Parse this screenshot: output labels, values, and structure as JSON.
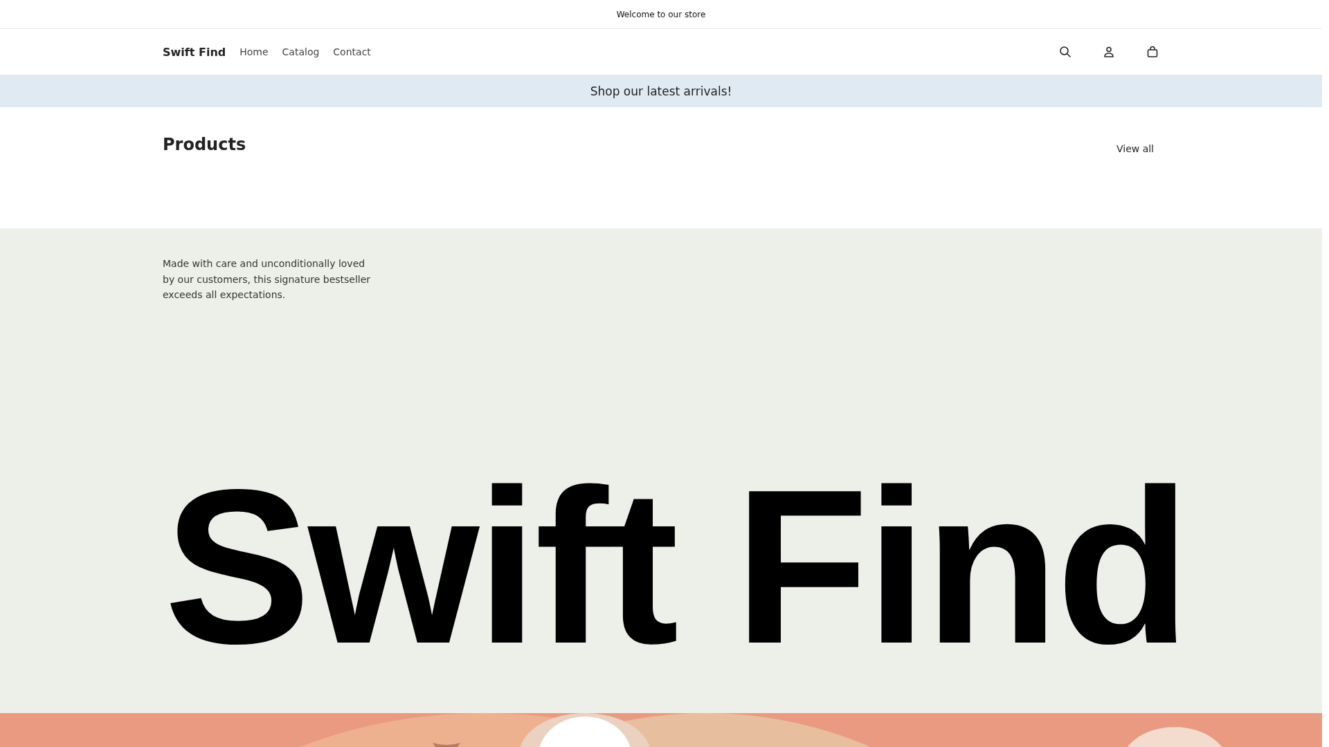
{
  "announcement": "Welcome to our store",
  "header": {
    "logo": "Swift Find",
    "nav": [
      {
        "label": "Home"
      },
      {
        "label": "Catalog"
      },
      {
        "label": "Contact"
      }
    ]
  },
  "banner": "Shop our latest arrivals!",
  "products": {
    "title": "Products",
    "link": "View all"
  },
  "feature": {
    "text": "Made with care and unconditionally loved by our customers, this signature bestseller exceeds all expectations.",
    "headline": "Swift Find"
  }
}
